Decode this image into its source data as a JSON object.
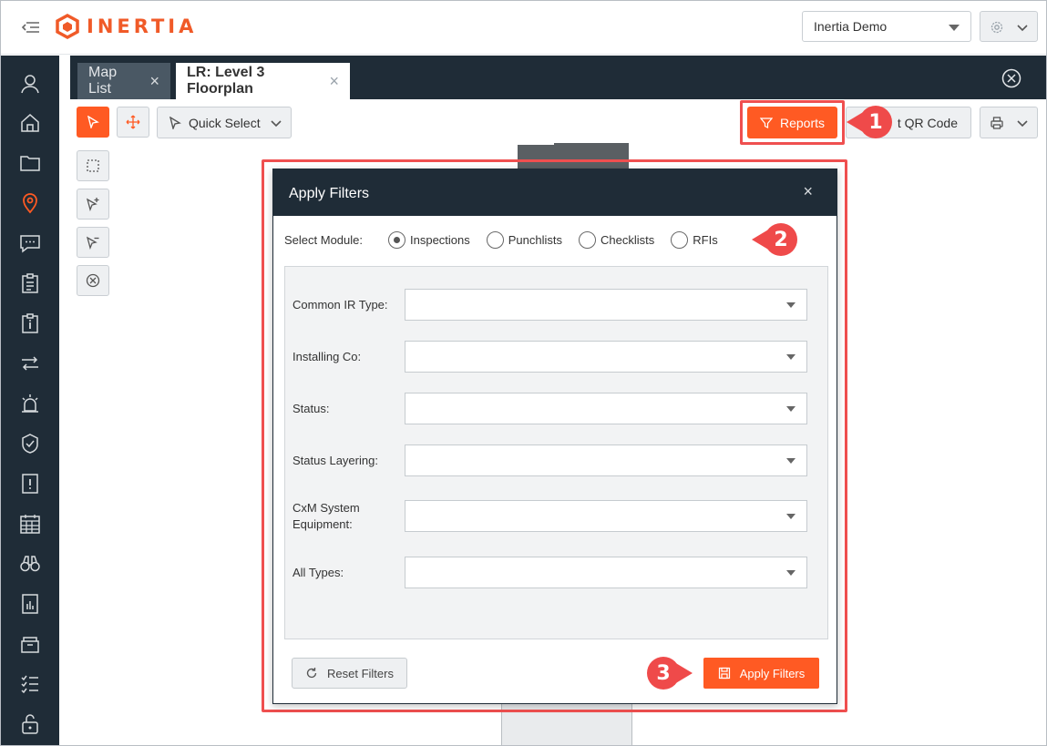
{
  "app": {
    "logo_text": "INERTIA"
  },
  "header": {
    "project_select": "Inertia Demo"
  },
  "tabs": [
    {
      "label": "Map List"
    },
    {
      "label": "LR: Level 3 Floorplan"
    }
  ],
  "toolbar": {
    "quick_select_label": "Quick Select",
    "reports_label": "Reports",
    "qr_label": "t QR Code"
  },
  "annotations": [
    "1",
    "2",
    "3"
  ],
  "modal": {
    "title": "Apply Filters",
    "close_glyph": "×",
    "module_label": "Select Module:",
    "modules": [
      {
        "label": "Inspections",
        "selected": true
      },
      {
        "label": "Punchlists",
        "selected": false
      },
      {
        "label": "Checklists",
        "selected": false
      },
      {
        "label": "RFIs",
        "selected": false
      }
    ],
    "filters": [
      {
        "label": "Common IR Type:",
        "value": ""
      },
      {
        "label": "Installing Co:",
        "value": ""
      },
      {
        "label": "Status:",
        "value": ""
      },
      {
        "label": "Status Layering:",
        "value": ""
      },
      {
        "label": "CxM System Equipment:",
        "value": ""
      },
      {
        "label": "All Types:",
        "value": ""
      }
    ],
    "reset_label": "Reset Filters",
    "apply_label": "Apply Filters"
  },
  "colors": {
    "accent": "#ff5a23",
    "nav_dark": "#1f2c37",
    "annotation": "#ef4a4a"
  }
}
